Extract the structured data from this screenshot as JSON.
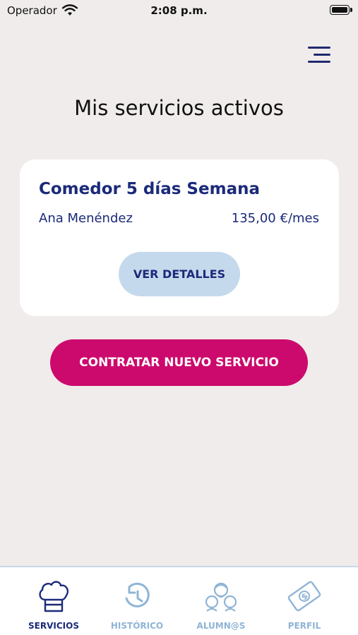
{
  "status": {
    "carrier": "Operador",
    "time": "2:08 p.m."
  },
  "page": {
    "title": "Mis servicios activos"
  },
  "service_card": {
    "title": "Comedor 5 días Semana",
    "student": "Ana Menéndez",
    "price": "135,00 €/mes",
    "details_label": "VER DETALLES"
  },
  "contract_label": "CONTRATAR NUEVO SERVICIO",
  "tabs": [
    {
      "label": "SERVICIOS",
      "icon": "chef-hat-icon",
      "active": true
    },
    {
      "label": "HISTÓRICO",
      "icon": "history-icon",
      "active": false
    },
    {
      "label": "ALUMN@S",
      "icon": "students-icon",
      "active": false
    },
    {
      "label": "PERFIL",
      "icon": "money-bill-icon",
      "active": false
    }
  ],
  "colors": {
    "primary": "#1b2a7a",
    "accent": "#cc0a6d",
    "details_bg": "#c5d9ec",
    "inactive_tab": "#8fb4d6",
    "background": "#f0ecec"
  }
}
